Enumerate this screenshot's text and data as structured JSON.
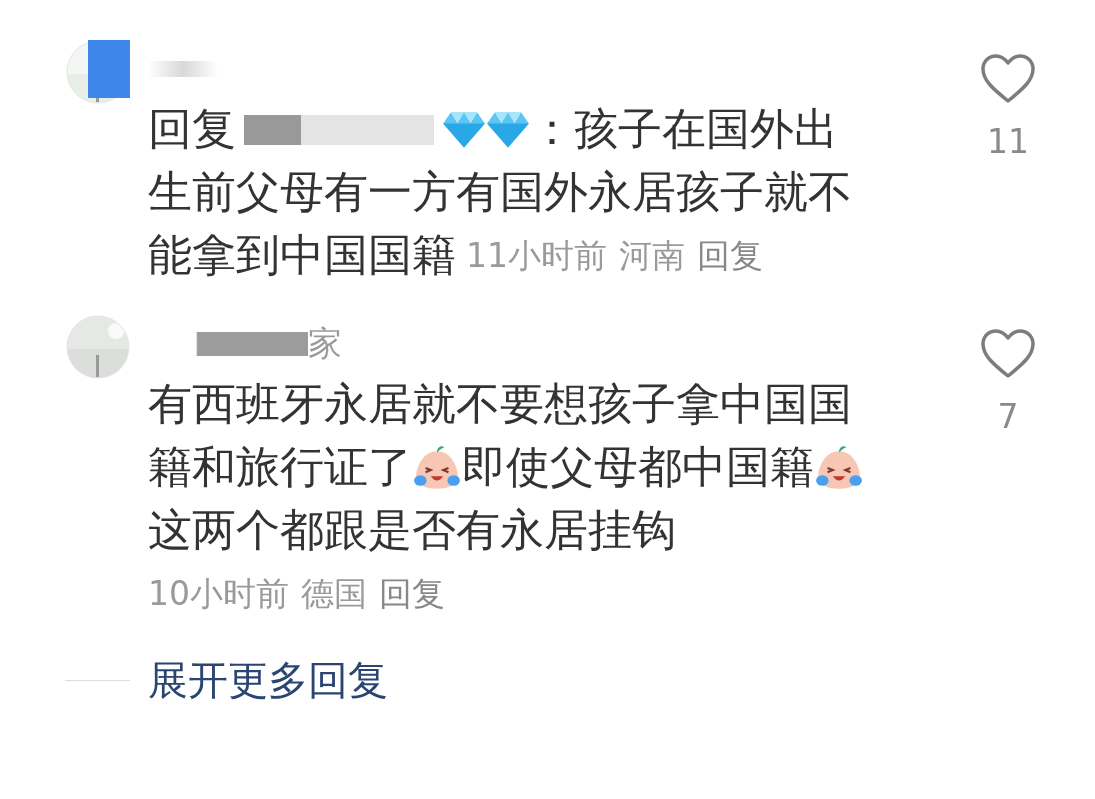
{
  "comments": [
    {
      "lines": [
        [
          {
            "kind": "text",
            "text": "回复"
          },
          {
            "kind": "redacted"
          },
          {
            "kind": "diamond"
          },
          {
            "kind": "diamond"
          },
          {
            "kind": "text",
            "text": "：孩子在国外出"
          }
        ],
        [
          {
            "kind": "text",
            "text": "生前父母有一方有国外永居孩子就不"
          }
        ],
        [
          {
            "kind": "text",
            "text": "能拿到中国国籍"
          },
          {
            "kind": "meta",
            "time": "11小时前",
            "location": "河南",
            "reply": "回复"
          }
        ]
      ],
      "likes": "11",
      "liked": false
    },
    {
      "author_visible": "家",
      "lines": [
        [
          {
            "kind": "text",
            "text": "有西班牙永居就不要想孩子拿中国国"
          }
        ],
        [
          {
            "kind": "text",
            "text": "籍和旅行证了"
          },
          {
            "kind": "laugh-cry"
          },
          {
            "kind": "text",
            "text": "即使父母都中国籍"
          },
          {
            "kind": "laugh-cry"
          }
        ],
        [
          {
            "kind": "text",
            "text": "这两个都跟是否有永居挂钩"
          }
        ],
        [
          {
            "kind": "meta",
            "time": "10小时前",
            "location": "德国",
            "reply": "回复"
          }
        ]
      ],
      "likes": "7",
      "liked": false
    }
  ],
  "expand": "展开更多回复"
}
